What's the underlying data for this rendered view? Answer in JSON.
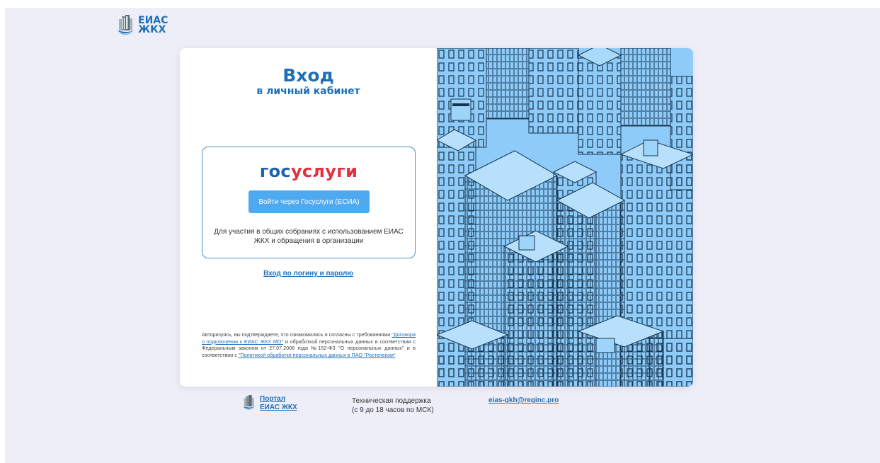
{
  "header": {
    "logo_line1": "ЕИАС",
    "logo_line2": "ЖКХ"
  },
  "login": {
    "title": "Вход",
    "subtitle": "в личный кабинет",
    "gosuslugi_logo_part1": "гос",
    "gosuslugi_logo_part2": "услуги",
    "gosuslugi_button": "Войти через Госуслуги (ЕСИА)",
    "gosuslugi_description": "Для участия в общих собраниях с использованием ЕИАС ЖКХ и обращения в организации",
    "password_login_link": "Вход по логину и паролю"
  },
  "agreement": {
    "text1": "Авторизуясь, вы подтверждаете, что ознакомились и согласны с требованиями ",
    "link1": "\"Договора о подключении к ЕИАС ЖКХ МО\"",
    "text2": " и обработкой персональных данных в соответствии с Федеральным законом от 27.07.2006 года №152-ФЗ \"О персональных данных\" и в соответствии с ",
    "link2": "\"Политикой обработки персональных данных в ПАО \"Ростелеком\""
  },
  "footer": {
    "portal_line1": "Портал",
    "portal_line2": "ЕИАС ЖКХ",
    "support_line1": "Техническая поддержка",
    "support_line2": "(с 9 до 18 часов по МСК)",
    "email": "eias-gkh@reginc.pro"
  },
  "colors": {
    "background": "#eeeef8",
    "brand_blue": "#1f6fb6",
    "button_blue": "#4fa9ee",
    "illustration_blue": "#8ecbf8",
    "gosuslugi_red": "#e3313f"
  },
  "icons": [
    "building-logo-icon",
    "city-illustration"
  ]
}
